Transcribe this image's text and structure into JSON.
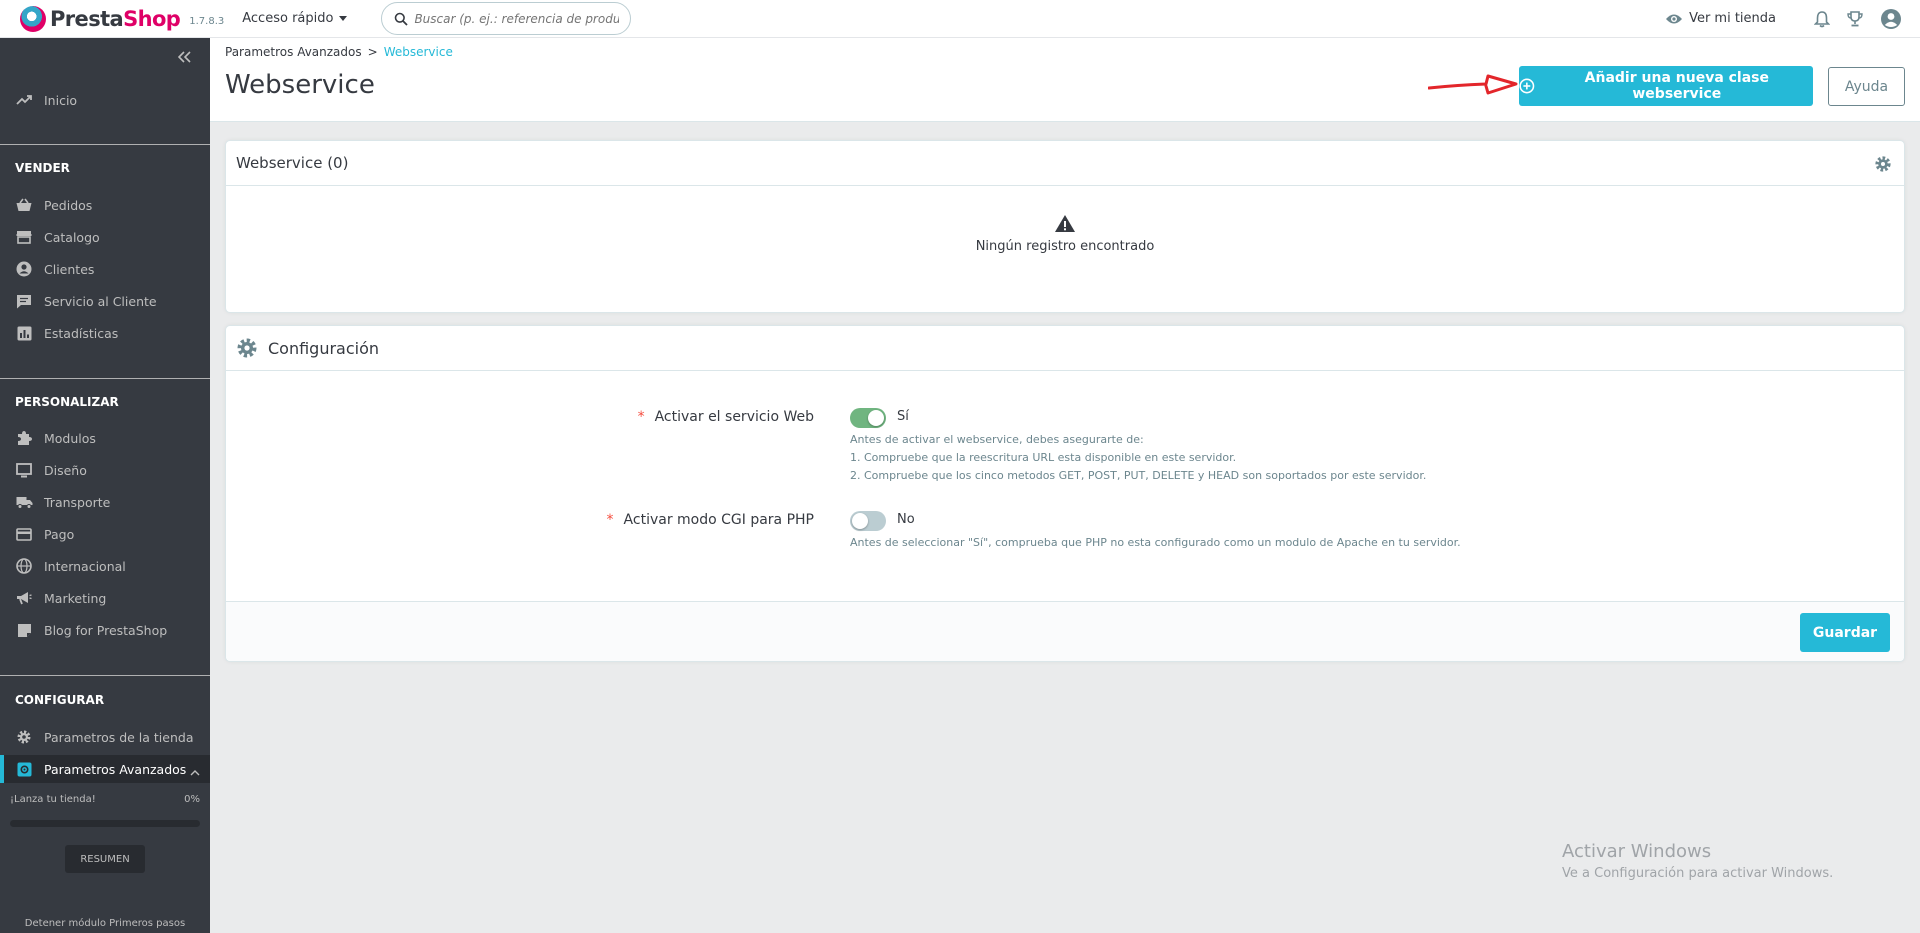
{
  "header": {
    "logo_part1": "Presta",
    "logo_part2": "Shop",
    "version": "1.7.8.3",
    "quick_access": "Acceso rápido",
    "search_placeholder": "Buscar (p. ej.: referencia de producto, nom",
    "view_store": "Ver mi tienda"
  },
  "sidebar": {
    "home": "Inicio",
    "sections": [
      {
        "title": "VENDER",
        "items": [
          "Pedidos",
          "Catalogo",
          "Clientes",
          "Servicio al Cliente",
          "Estadísticas"
        ]
      },
      {
        "title": "PERSONALIZAR",
        "items": [
          "Modulos",
          "Diseño",
          "Transporte",
          "Pago",
          "Internacional",
          "Marketing",
          "Blog for PrestaShop"
        ]
      },
      {
        "title": "CONFIGURAR",
        "items": [
          "Parametros de la tienda",
          "Parametros Avanzados"
        ]
      }
    ],
    "launch_label": "¡Lanza tu tienda!",
    "launch_percent": "0%",
    "launch_progress": 0,
    "summary_button": "RESUMEN",
    "stop_module": "Detener módulo Primeros pasos"
  },
  "page": {
    "breadcrumb_parent": "Parametros Avanzados",
    "breadcrumb_sep": ">",
    "breadcrumb_current": "Webservice",
    "title": "Webservice",
    "add_button": "Añadir una nueva clase webservice",
    "help_button": "Ayuda"
  },
  "list_panel": {
    "title": "Webservice (0)",
    "empty_message": "Ningún registro encontrado"
  },
  "config_panel": {
    "title": "Configuración",
    "fields": [
      {
        "label": "Activar el servicio Web",
        "state": "Sí",
        "on": true,
        "help": [
          "Antes de activar el webservice, debes asegurarte de:",
          "1. Compruebe que la reescritura URL esta disponible en este servidor.",
          "2. Compruebe que los cinco metodos GET, POST, PUT, DELETE y HEAD son soportados por este servidor."
        ]
      },
      {
        "label": "Activar modo CGI para PHP",
        "state": "No",
        "on": false,
        "help": [
          "Antes de seleccionar \"Sí\", comprueba que PHP no esta configurado como un modulo de Apache en tu servidor."
        ]
      }
    ],
    "save_button": "Guardar"
  },
  "watermark": {
    "line1": "Activar Windows",
    "line2": "Ve a Configuración para activar Windows."
  },
  "colors": {
    "accent": "#25b9d7",
    "sidebar_bg": "#363a41",
    "switch_on": "#70b580",
    "required": "#f54c3e",
    "annotation_arrow": "#e3262b"
  }
}
